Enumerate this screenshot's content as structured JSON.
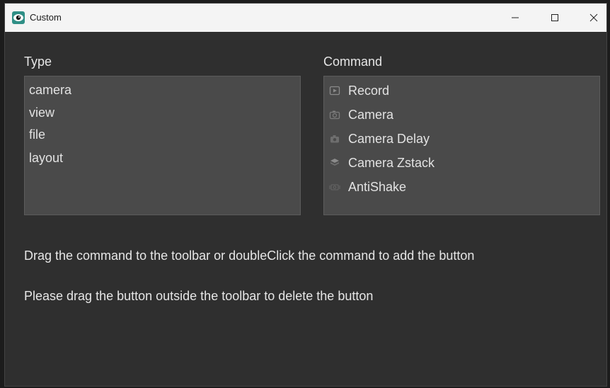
{
  "window": {
    "title": "Custom",
    "controls": [
      "minimize",
      "maximize",
      "close"
    ]
  },
  "type_panel": {
    "label": "Type",
    "items": [
      "camera",
      "view",
      "file",
      "layout"
    ]
  },
  "command_panel": {
    "label": "Command",
    "items": [
      {
        "label": "Record",
        "icon": "record-icon"
      },
      {
        "label": "Camera",
        "icon": "camera-icon"
      },
      {
        "label": "Camera Delay",
        "icon": "camera-delay-icon"
      },
      {
        "label": "Camera Zstack",
        "icon": "zstack-icon"
      },
      {
        "label": "AntiShake",
        "icon": "antishake-icon"
      }
    ]
  },
  "instructions": {
    "line1": "Drag the command to the toolbar or doubleClick the command to add the button",
    "line2": "Please drag the button outside the toolbar to delete the button"
  }
}
